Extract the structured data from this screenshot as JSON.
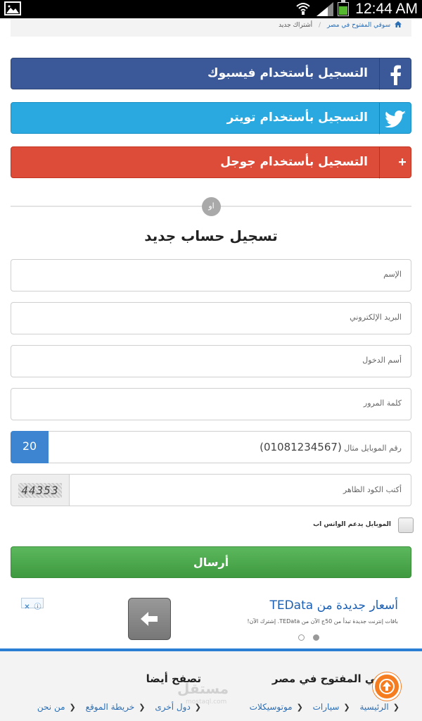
{
  "status_bar": {
    "time": "12:44 AM",
    "icons": [
      "gallery-icon",
      "wifi-icon",
      "signal-icon",
      "battery-icon"
    ]
  },
  "breadcrumb": {
    "home": "سوقي المفتوح في مصر",
    "separator": "/",
    "current": "أشتراك جديد"
  },
  "social": {
    "facebook": "التسجيل بأستخدام فيسبوك",
    "twitter": "التسجيل بأستخدام تويتر",
    "google": "التسجيل بأستخدام جوجل",
    "colors": {
      "facebook": "#3b5998",
      "twitter": "#2aa9e0",
      "google": "#dd4b39"
    }
  },
  "divider": {
    "or_label": "او"
  },
  "form": {
    "title": "تسجيل حساب جديد",
    "name_placeholder": "الإسم",
    "email_placeholder": "البريد الإلكتروني",
    "username_placeholder": "أسم الدخول",
    "password_placeholder": "كلمة المرور",
    "mobile_prefix": "20",
    "mobile_label": "رقم الموبايل  مثال",
    "mobile_example": "(01081234567)",
    "captcha_code": "44353",
    "captcha_placeholder": "أكتب الكود الظاهر",
    "whatsapp_label": "الموبايل يدعم الواتس اب",
    "submit_label": "أرسال",
    "submit_color": "#5cb85c"
  },
  "ad": {
    "title": "أسعار جديدة من TEData",
    "subtitle": "باقات إنترنت جديدة تبدأ من 50ج الآن من TEData. إشترك الآن!",
    "close_icons": [
      "close-icon",
      "info-icon"
    ]
  },
  "footer": {
    "col1_title": "سوقي المفتوح في مصر",
    "col2_title": "تصفح أيضا",
    "col1_links": [
      "الرئيسية",
      "سيارات",
      "موتوسيكلات"
    ],
    "col2_links": [
      "دول أخرى",
      "خريطة الموقع",
      "من نحن"
    ],
    "watermark": "مستقل",
    "watermark_sub": "mostaql.com",
    "accent": "#2a7fd4"
  }
}
